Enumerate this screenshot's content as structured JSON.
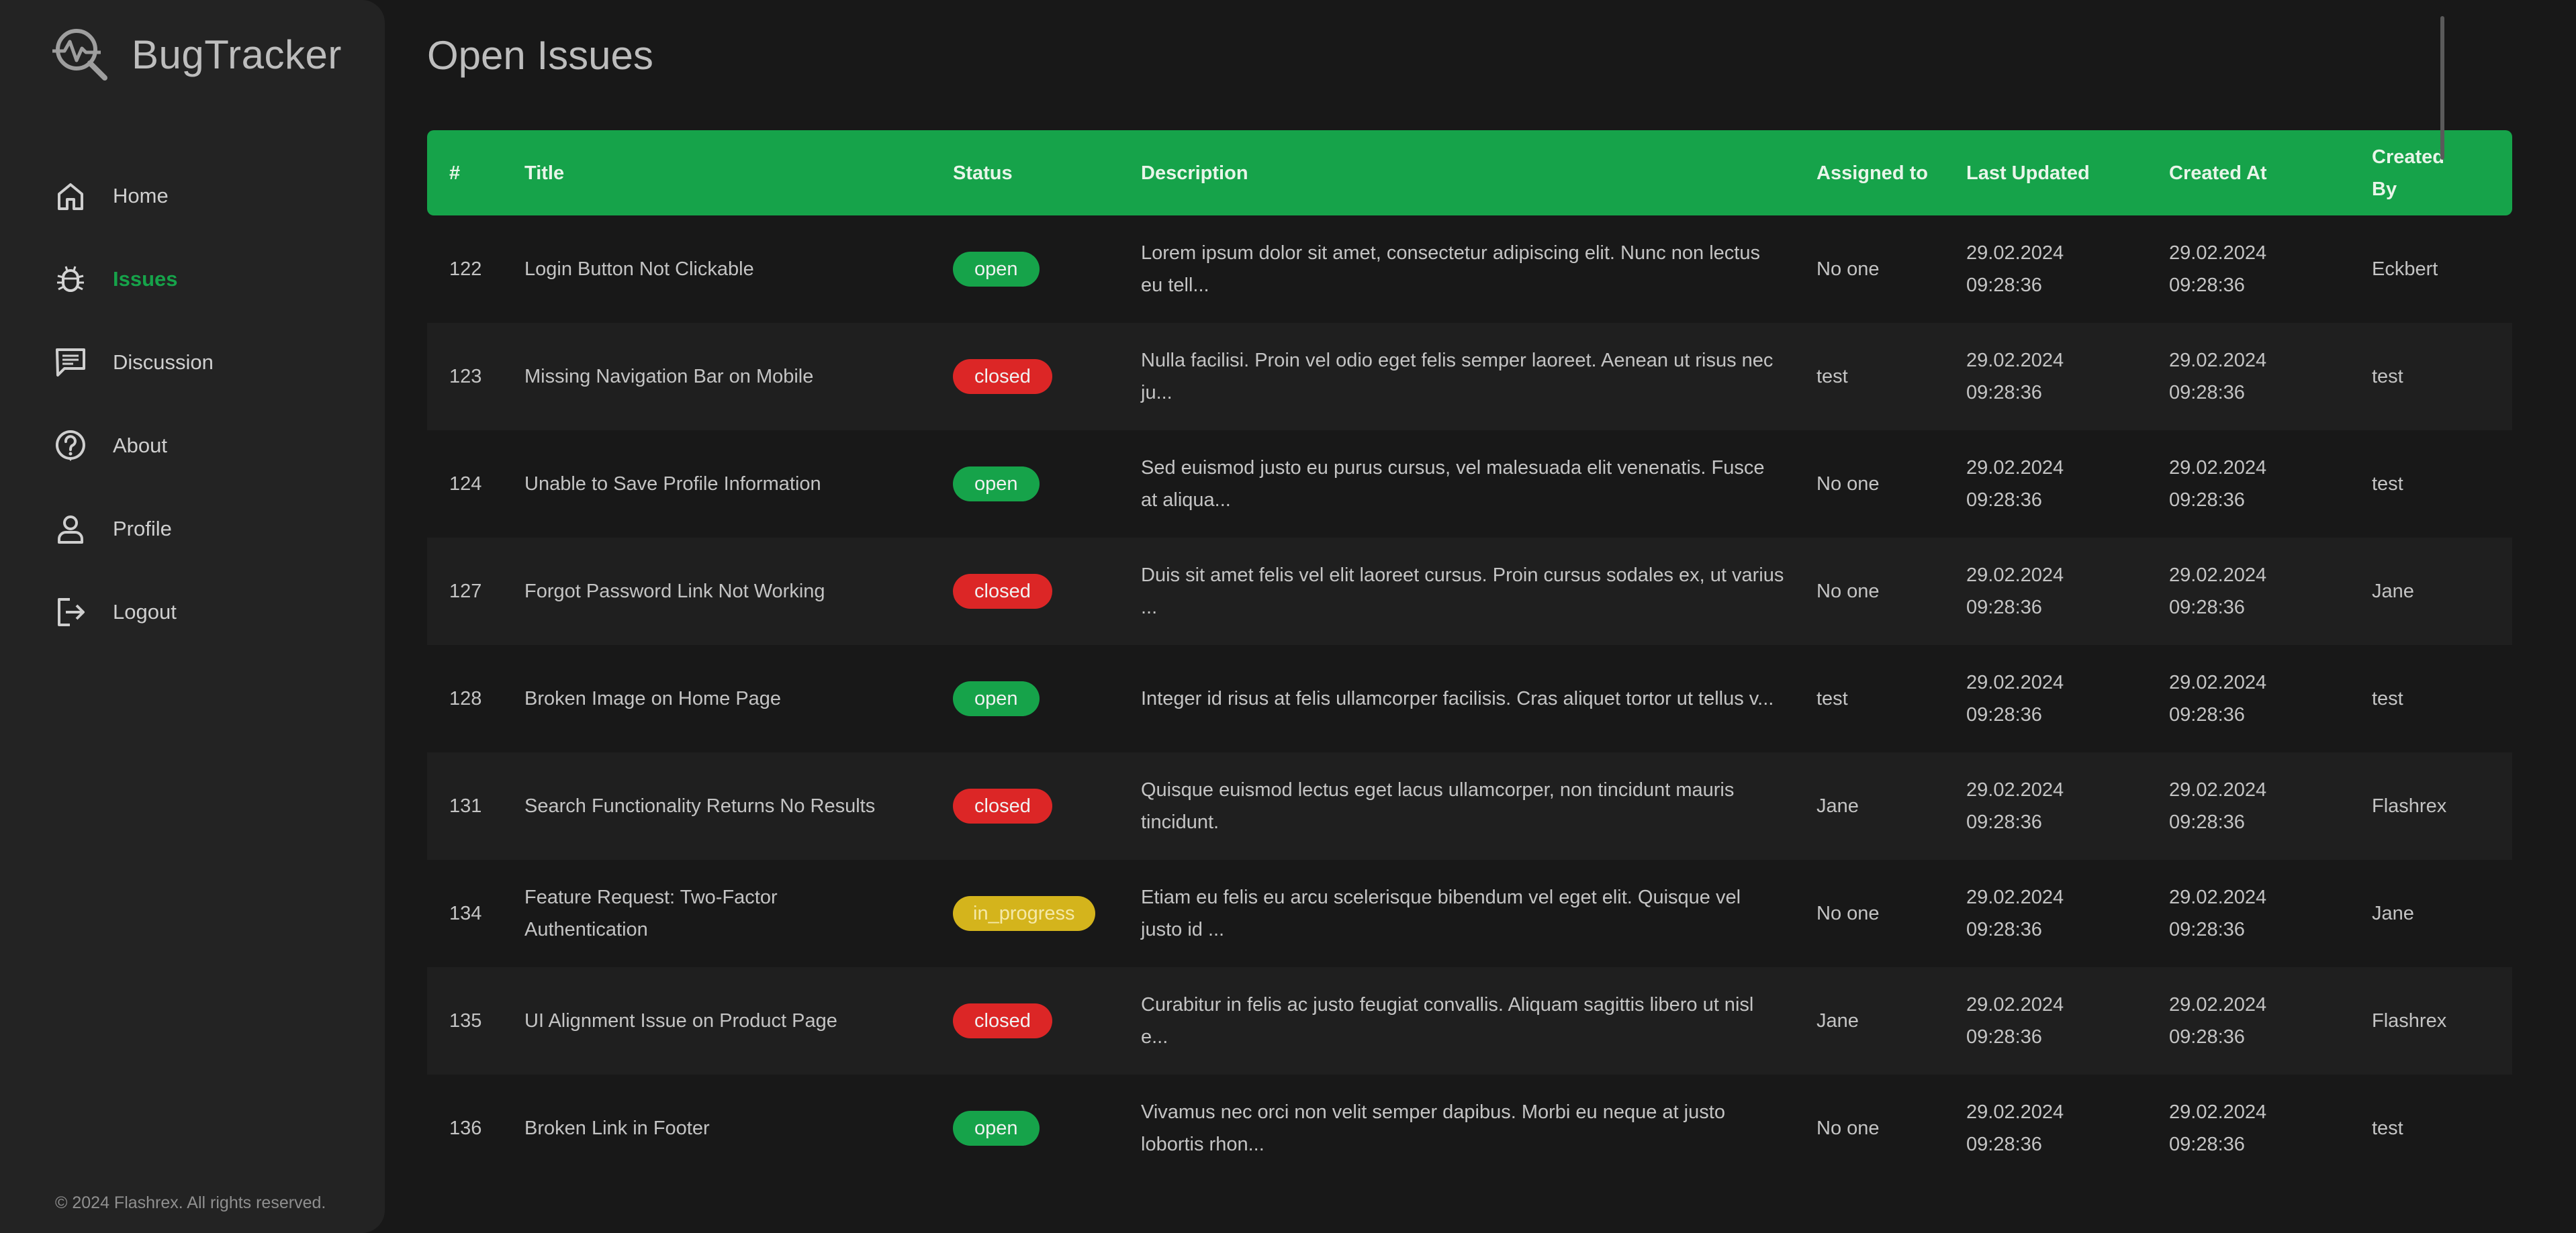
{
  "app": {
    "name": "BugTracker",
    "footer": "© 2024 Flashrex. All rights reserved."
  },
  "sidebar": {
    "items": [
      {
        "label": "Home",
        "icon": "home-icon",
        "active": false
      },
      {
        "label": "Issues",
        "icon": "bug-icon",
        "active": true
      },
      {
        "label": "Discussion",
        "icon": "chat-icon",
        "active": false
      },
      {
        "label": "About",
        "icon": "help-icon",
        "active": false
      },
      {
        "label": "Profile",
        "icon": "user-icon",
        "active": false
      },
      {
        "label": "Logout",
        "icon": "logout-icon",
        "active": false
      }
    ]
  },
  "page": {
    "title": "Open Issues"
  },
  "table": {
    "headers": [
      "#",
      "Title",
      "Status",
      "Description",
      "Assigned to",
      "Last Updated",
      "Created At",
      "Created By"
    ],
    "rows": [
      {
        "id": "122",
        "title": "Login Button Not Clickable",
        "status": "open",
        "description": "Lorem ipsum dolor sit amet, consectetur adipiscing elit. Nunc non lectus eu tell...",
        "assigned": "No one",
        "updated": "29.02.2024 09:28:36",
        "created": "29.02.2024 09:28:36",
        "by": "Eckbert"
      },
      {
        "id": "123",
        "title": "Missing Navigation Bar on Mobile",
        "status": "closed",
        "description": "Nulla facilisi. Proin vel odio eget felis semper laoreet. Aenean ut risus nec ju...",
        "assigned": "test",
        "updated": "29.02.2024 09:28:36",
        "created": "29.02.2024 09:28:36",
        "by": "test"
      },
      {
        "id": "124",
        "title": "Unable to Save Profile Information",
        "status": "open",
        "description": "Sed euismod justo eu purus cursus, vel malesuada elit venenatis. Fusce at aliqua...",
        "assigned": "No one",
        "updated": "29.02.2024 09:28:36",
        "created": "29.02.2024 09:28:36",
        "by": "test"
      },
      {
        "id": "127",
        "title": "Forgot Password Link Not Working",
        "status": "closed",
        "description": "Duis sit amet felis vel elit laoreet cursus. Proin cursus sodales ex, ut varius ...",
        "assigned": "No one",
        "updated": "29.02.2024 09:28:36",
        "created": "29.02.2024 09:28:36",
        "by": "Jane"
      },
      {
        "id": "128",
        "title": "Broken Image on Home Page",
        "status": "open",
        "description": "Integer id risus at felis ullamcorper facilisis. Cras aliquet tortor ut tellus v...",
        "assigned": "test",
        "updated": "29.02.2024 09:28:36",
        "created": "29.02.2024 09:28:36",
        "by": "test"
      },
      {
        "id": "131",
        "title": "Search Functionality Returns No Results",
        "status": "closed",
        "description": "Quisque euismod lectus eget lacus ullamcorper, non tincidunt mauris tincidunt.",
        "assigned": "Jane",
        "updated": "29.02.2024 09:28:36",
        "created": "29.02.2024 09:28:36",
        "by": "Flashrex"
      },
      {
        "id": "134",
        "title": "Feature Request: Two-Factor Authentication",
        "status": "in_progress",
        "description": "Etiam eu felis eu arcu scelerisque bibendum vel eget elit. Quisque vel justo id ...",
        "assigned": "No one",
        "updated": "29.02.2024 09:28:36",
        "created": "29.02.2024 09:28:36",
        "by": "Jane"
      },
      {
        "id": "135",
        "title": "UI Alignment Issue on Product Page",
        "status": "closed",
        "description": "Curabitur in felis ac justo feugiat convallis. Aliquam sagittis libero ut nisl e...",
        "assigned": "Jane",
        "updated": "29.02.2024 09:28:36",
        "created": "29.02.2024 09:28:36",
        "by": "Flashrex"
      },
      {
        "id": "136",
        "title": "Broken Link in Footer",
        "status": "open",
        "description": "Vivamus nec orci non velit semper dapibus. Morbi eu neque at justo lobortis rhon...",
        "assigned": "No one",
        "updated": "29.02.2024 09:28:36",
        "created": "29.02.2024 09:28:36",
        "by": "test"
      }
    ]
  },
  "colors": {
    "accent": "#16a34a",
    "closed": "#dc2626",
    "in_progress": "#d4b41c",
    "background": "#181818",
    "sidebar": "#232323"
  }
}
